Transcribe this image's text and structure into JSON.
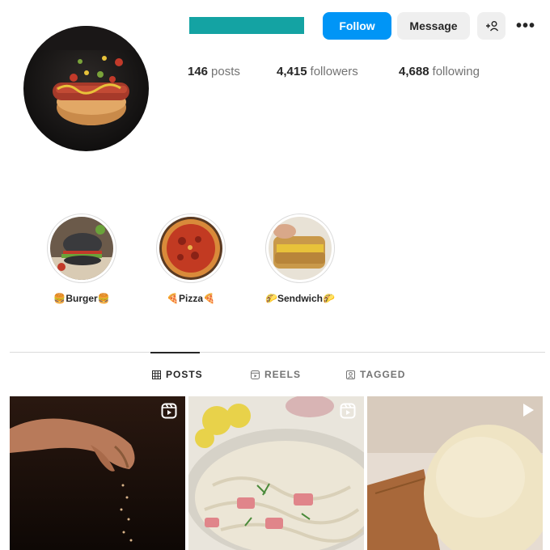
{
  "header": {
    "follow_label": "Follow",
    "message_label": "Message",
    "more_label": "•••"
  },
  "stats": {
    "posts_count": "146",
    "posts_label": "posts",
    "followers_count": "4,415",
    "followers_label": "followers",
    "following_count": "4,688",
    "following_label": "following"
  },
  "highlights": [
    {
      "label": "🍔Burger🍔"
    },
    {
      "label": "🍕Pizza🍕"
    },
    {
      "label": "🌮Sendwich🌮"
    }
  ],
  "tabs": [
    {
      "label": "POSTS",
      "icon": "grid-icon",
      "active": true
    },
    {
      "label": "REELS",
      "icon": "reels-icon",
      "active": false
    },
    {
      "label": "TAGGED",
      "icon": "tagged-icon",
      "active": false
    }
  ],
  "colors": {
    "follow_button": "#0095f6",
    "name_redaction": "#14a3a3"
  }
}
